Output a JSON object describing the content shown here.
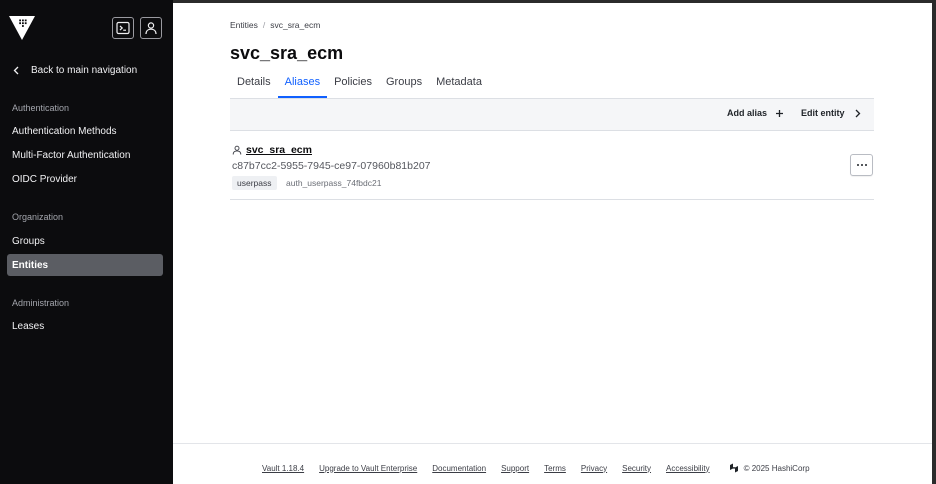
{
  "sidebar": {
    "back_label": "Back to main navigation",
    "sections": [
      {
        "heading": "Authentication",
        "items": [
          "Authentication Methods",
          "Multi-Factor Authentication",
          "OIDC Provider"
        ]
      },
      {
        "heading": "Organization",
        "items": [
          "Groups",
          "Entities"
        ]
      },
      {
        "heading": "Administration",
        "items": [
          "Leases"
        ]
      }
    ],
    "active_item": "Entities"
  },
  "breadcrumb": {
    "parent": "Entities",
    "separator": "/",
    "current": "svc_sra_ecm"
  },
  "page_title": "svc_sra_ecm",
  "tabs": [
    {
      "label": "Details",
      "active": false
    },
    {
      "label": "Aliases",
      "active": true
    },
    {
      "label": "Policies",
      "active": false
    },
    {
      "label": "Groups",
      "active": false
    },
    {
      "label": "Metadata",
      "active": false
    }
  ],
  "toolbar": {
    "add_alias_label": "Add alias",
    "edit_entity_label": "Edit entity"
  },
  "alias": {
    "name": "svc_sra_ecm",
    "id": "c87b7cc2-5955-7945-ce97-07960b81b207",
    "mount_type": "userpass",
    "mount_accessor": "auth_userpass_74fbdc21"
  },
  "footer": {
    "links": [
      "Vault 1.18.4",
      "Upgrade to Vault Enterprise",
      "Documentation",
      "Support",
      "Terms",
      "Privacy",
      "Security",
      "Accessibility"
    ],
    "copyright": "© 2025 HashiCorp"
  },
  "colors": {
    "sidebar_bg": "#0c0c0e",
    "accent": "#1060ff",
    "active_nav_bg": "#5b5d63"
  }
}
